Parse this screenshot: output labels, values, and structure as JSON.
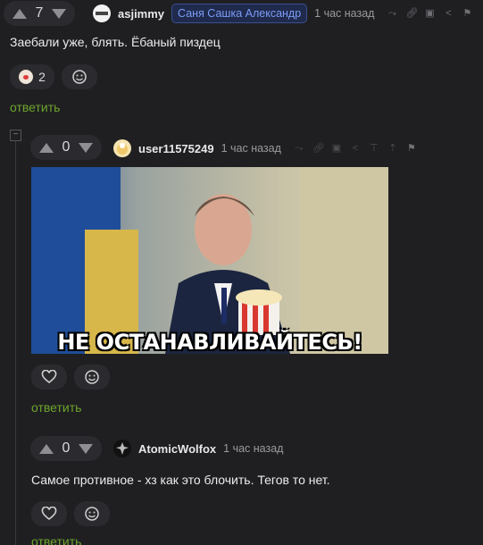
{
  "comments": [
    {
      "votes": "7",
      "username": "asjimmy",
      "tag": "Саня Сашка Александр",
      "time": "1 час назад",
      "text": "Заебали уже, блять. Ёбаный пиздец",
      "reaction_count": "2",
      "reply_label": "ответить"
    },
    {
      "votes": "0",
      "username": "user11575249",
      "time": "1 час назад",
      "image_caption": "НЕ ОСТАНАВЛИВАЙТЕСЬ!",
      "reply_label": "ответить"
    },
    {
      "votes": "0",
      "username": "AtomicWolfox",
      "time": "1 час назад",
      "text": "Самое противное - хз как это блочить. Тегов то нет.",
      "reply_label": "ответить"
    }
  ],
  "colors": {
    "background": "#1f1f22",
    "reply_link": "#6ea52c",
    "tag_text": "#7c9cf5",
    "pill": "#2b2b2f"
  },
  "icons": [
    "upvote-icon",
    "downvote-icon",
    "share-icon",
    "link-icon",
    "save-icon",
    "report-icon",
    "heart-icon",
    "add-reaction-icon",
    "clown-emoji-icon"
  ]
}
